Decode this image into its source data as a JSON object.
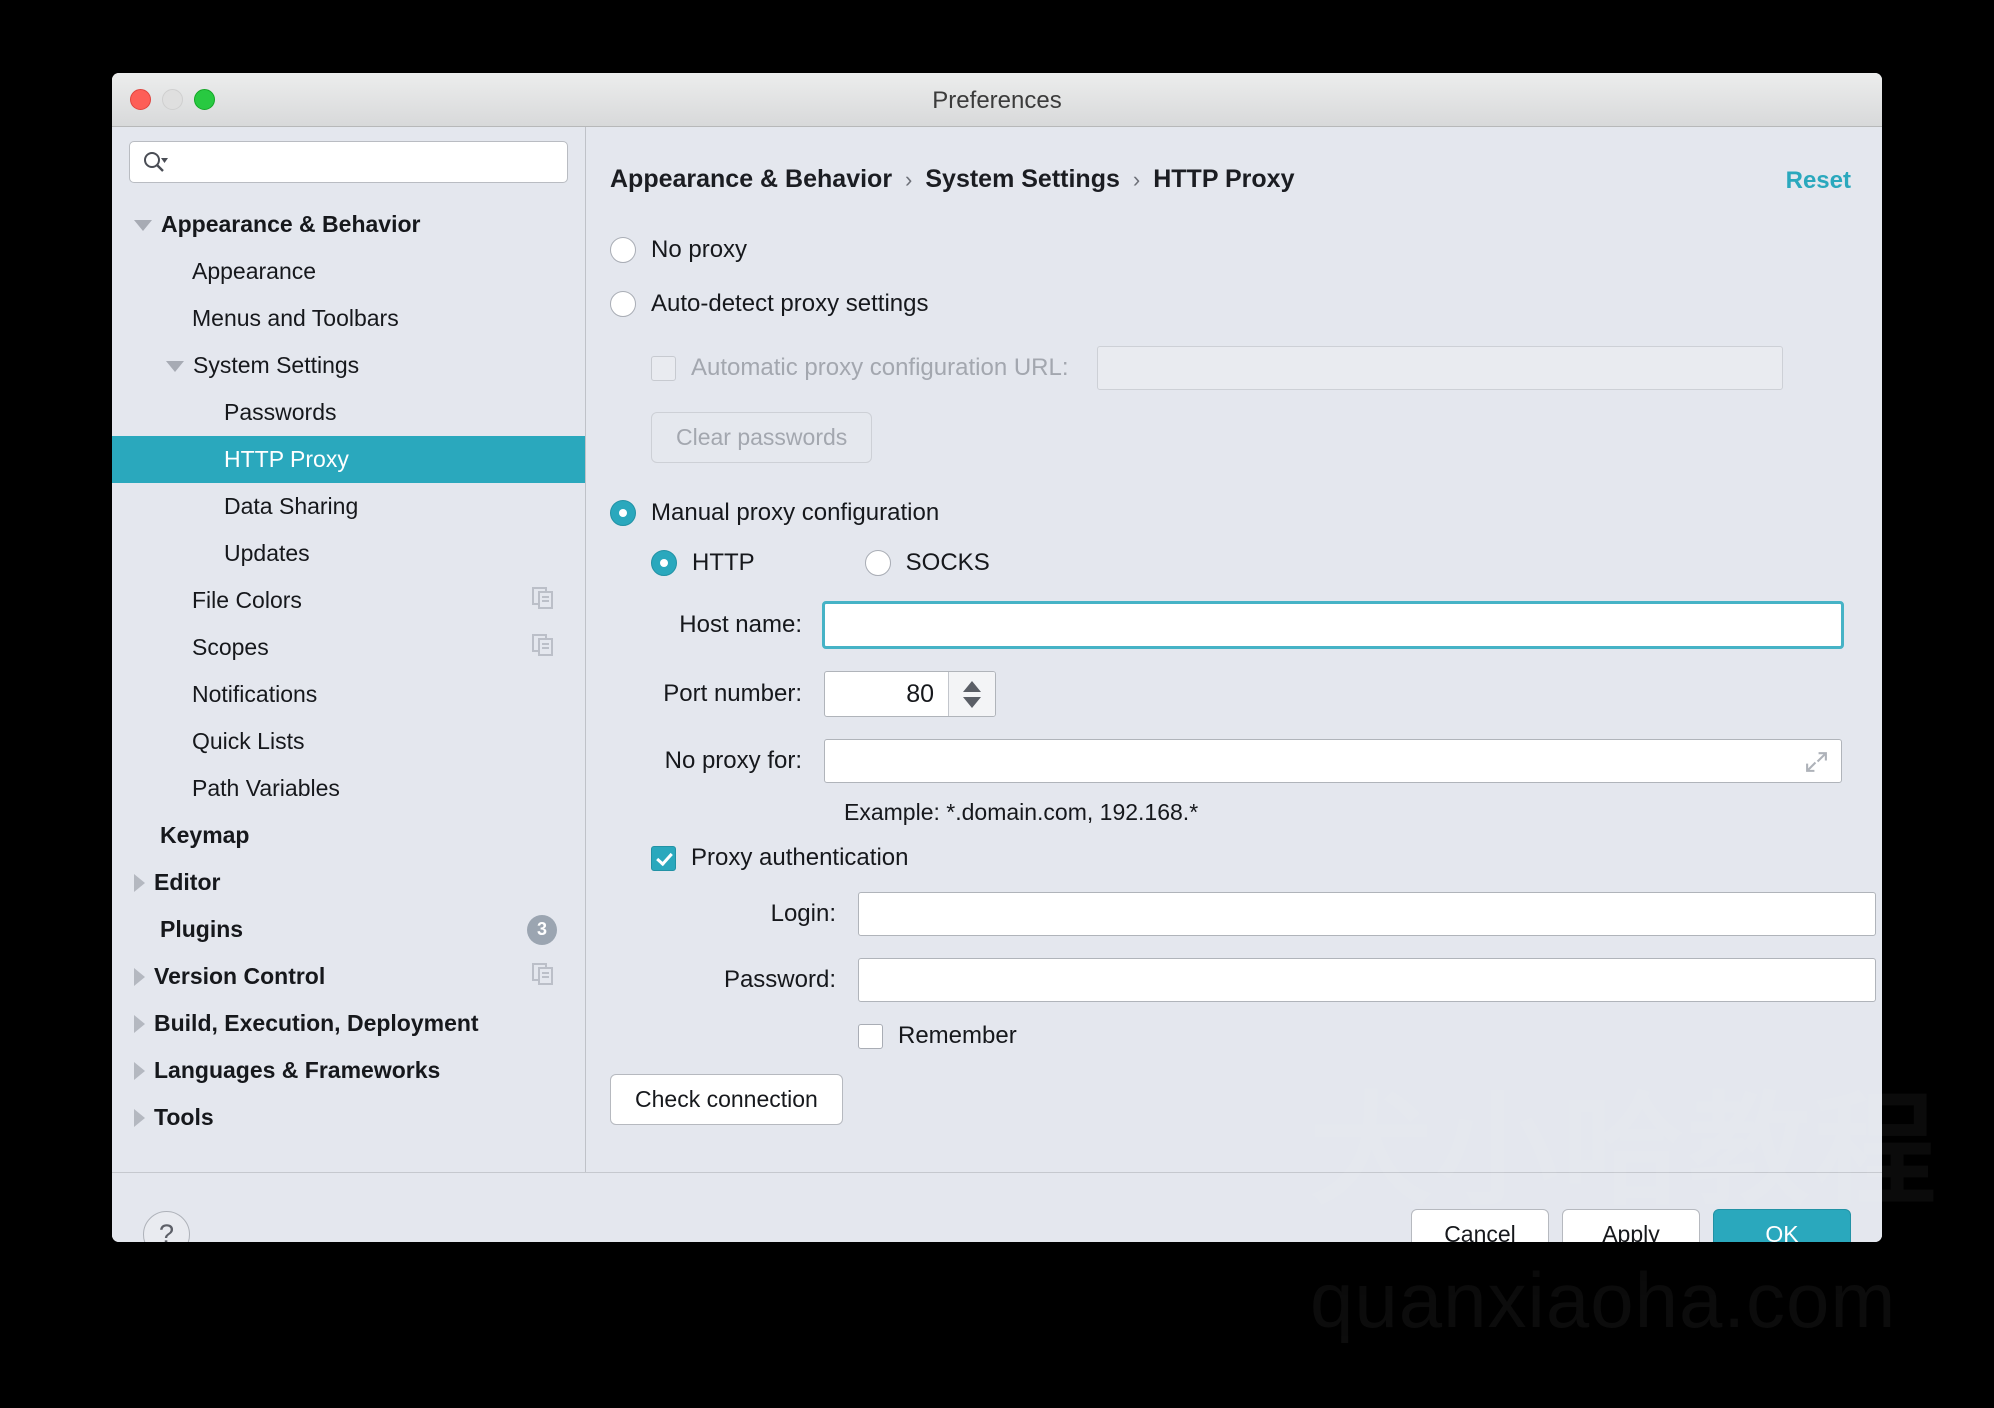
{
  "window": {
    "title": "Preferences",
    "traffic_lights": [
      "close-red",
      "minimize-yellow",
      "maximize-green"
    ]
  },
  "sidebar": {
    "search": {
      "placeholder": "",
      "value": "",
      "icon": "search-icon"
    },
    "items": [
      {
        "label": "Appearance & Behavior",
        "indent": 0,
        "twisty": "down",
        "bold": true,
        "selected": false
      },
      {
        "label": "Appearance",
        "indent": 1,
        "twisty": "none",
        "bold": false,
        "selected": false
      },
      {
        "label": "Menus and Toolbars",
        "indent": 1,
        "twisty": "none",
        "bold": false,
        "selected": false
      },
      {
        "label": "System Settings",
        "indent": 1,
        "twisty": "down",
        "bold": false,
        "selected": false
      },
      {
        "label": "Passwords",
        "indent": 2,
        "twisty": "none",
        "bold": false,
        "selected": false
      },
      {
        "label": "HTTP Proxy",
        "indent": 2,
        "twisty": "none",
        "bold": false,
        "selected": true
      },
      {
        "label": "Data Sharing",
        "indent": 2,
        "twisty": "none",
        "bold": false,
        "selected": false
      },
      {
        "label": "Updates",
        "indent": 2,
        "twisty": "none",
        "bold": false,
        "selected": false
      },
      {
        "label": "File Colors",
        "indent": 1,
        "twisty": "none",
        "bold": false,
        "selected": false,
        "trailing": "copy-icon"
      },
      {
        "label": "Scopes",
        "indent": 1,
        "twisty": "none",
        "bold": false,
        "selected": false,
        "trailing": "copy-icon"
      },
      {
        "label": "Notifications",
        "indent": 1,
        "twisty": "none",
        "bold": false,
        "selected": false
      },
      {
        "label": "Quick Lists",
        "indent": 1,
        "twisty": "none",
        "bold": false,
        "selected": false
      },
      {
        "label": "Path Variables",
        "indent": 1,
        "twisty": "none",
        "bold": false,
        "selected": false
      },
      {
        "label": "Keymap",
        "indent": 0,
        "twisty": "none",
        "bold": true,
        "selected": false
      },
      {
        "label": "Editor",
        "indent": 0,
        "twisty": "right",
        "bold": true,
        "selected": false
      },
      {
        "label": "Plugins",
        "indent": 0,
        "twisty": "none",
        "bold": true,
        "selected": false,
        "badge": "3"
      },
      {
        "label": "Version Control",
        "indent": 0,
        "twisty": "right",
        "bold": true,
        "selected": false,
        "trailing": "copy-icon"
      },
      {
        "label": "Build, Execution, Deployment",
        "indent": 0,
        "twisty": "right",
        "bold": true,
        "selected": false
      },
      {
        "label": "Languages & Frameworks",
        "indent": 0,
        "twisty": "right",
        "bold": true,
        "selected": false
      },
      {
        "label": "Tools",
        "indent": 0,
        "twisty": "right",
        "bold": true,
        "selected": false
      }
    ]
  },
  "content": {
    "breadcrumb": [
      "Appearance & Behavior",
      "System Settings",
      "HTTP Proxy"
    ],
    "breadcrumb_separator": "›",
    "reset_label": "Reset",
    "proxy_mode": "manual",
    "options": {
      "no_proxy_label": "No proxy",
      "auto_detect_label": "Auto-detect proxy settings",
      "auto_config_checkbox_label": "Automatic proxy configuration URL:",
      "auto_config_url_value": "",
      "clear_passwords_label": "Clear passwords",
      "manual_label": "Manual proxy configuration",
      "protocol_http_label": "HTTP",
      "protocol_socks_label": "SOCKS",
      "protocol_selected": "HTTP"
    },
    "fields": {
      "host_name_label": "Host name:",
      "host_name_value": "",
      "port_number_label": "Port number:",
      "port_number_value": "80",
      "no_proxy_for_label": "No proxy for:",
      "no_proxy_for_value": "",
      "example_hint": "Example: *.domain.com, 192.168.*",
      "proxy_auth_label": "Proxy authentication",
      "proxy_auth_checked": true,
      "login_label": "Login:",
      "login_value": "",
      "password_label": "Password:",
      "password_value": "",
      "remember_label": "Remember",
      "remember_checked": false,
      "check_connection_label": "Check connection"
    }
  },
  "footer": {
    "help_label": "?",
    "cancel_label": "Cancel",
    "apply_label": "Apply",
    "ok_label": "OK"
  },
  "watermark": {
    "cn_text": "犬小哈教程",
    "url_text": "quanxiaoha.com"
  },
  "colors": {
    "accent": "#2aa8bd",
    "window_bg": "#e4e7ee",
    "selection": "#2aa8bd"
  }
}
